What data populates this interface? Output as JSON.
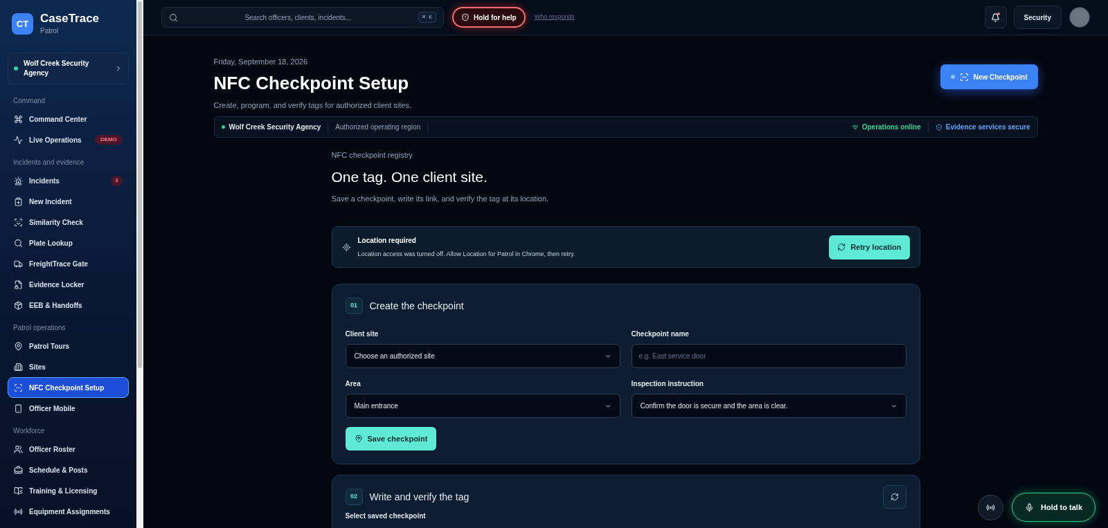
{
  "sidebar": {
    "brand": {
      "logo": "CT",
      "name": "CaseTrace",
      "product": "Patrol"
    },
    "agency": {
      "name": "Wolf Creek Security Agency",
      "online": true
    },
    "sections": [
      {
        "label": "Command",
        "items": [
          {
            "label": "Command Center",
            "selected": false
          },
          {
            "label": "Live Operations",
            "selected": false,
            "badge": {
              "kind": "demo",
              "text": "DEMO"
            }
          }
        ]
      },
      {
        "label": "Incidents and evidence",
        "items": [
          {
            "label": "Incidents",
            "selected": false,
            "badge": {
              "kind": "count",
              "text": "3"
            }
          },
          {
            "label": "New Incident",
            "selected": false
          },
          {
            "label": "Similarity Check",
            "selected": false
          },
          {
            "label": "Plate Lookup",
            "selected": false
          },
          {
            "label": "FreightTrace Gate",
            "selected": false
          },
          {
            "label": "Evidence Locker",
            "selected": false
          },
          {
            "label": "EEB & Handoffs",
            "selected": false
          }
        ]
      },
      {
        "label": "Patrol operations",
        "items": [
          {
            "label": "Patrol Tours",
            "selected": false
          },
          {
            "label": "Sites",
            "selected": false
          },
          {
            "label": "NFC Checkpoint Setup",
            "selected": true
          },
          {
            "label": "Officer Mobile",
            "selected": false
          }
        ]
      },
      {
        "label": "Workforce",
        "items": [
          {
            "label": "Officer Roster",
            "selected": false
          },
          {
            "label": "Schedule & Posts",
            "selected": false
          },
          {
            "label": "Training & Licensing",
            "selected": false
          },
          {
            "label": "Equipment Assignments",
            "selected": false
          }
        ]
      }
    ]
  },
  "topbar": {
    "search": {
      "placeholder": "Search officers, clients, incidents...",
      "shortcut": "⌘ K"
    },
    "help_button": "Hold for help",
    "help_link": "Who responds",
    "notifications": {
      "unread": true
    },
    "role_button": "Security"
  },
  "page": {
    "date": "Friday, September 18, 2026",
    "title": "NFC Checkpoint Setup",
    "subtitle": "Create, program, and verify tags for authorized client sites.",
    "primary_button": "New Checkpoint",
    "status_strip": {
      "agency": "Wolf Creek Security Agency",
      "region": "Authorized operating region",
      "operations": "Operations online",
      "evidence": "Evidence services secure"
    }
  },
  "registry": {
    "eyebrow": "NFC checkpoint registry",
    "heading": "One tag. One client site.",
    "description": "Save a checkpoint, write its link, and verify the tag at its location."
  },
  "alert": {
    "title": "Location required",
    "message": "Location access was turned off. Allow Location for Patrol in Chrome, then retry.",
    "button": "Retry location"
  },
  "steps": [
    {
      "number": "01",
      "title": "Create the checkpoint",
      "fields": [
        {
          "label": "Client site",
          "kind": "select",
          "value": "Choose an authorized site"
        },
        {
          "label": "Checkpoint name",
          "kind": "input",
          "placeholder": "e.g. East service door"
        },
        {
          "label": "Area",
          "kind": "select",
          "value": "Main entrance"
        },
        {
          "label": "Inspection instruction",
          "kind": "select",
          "value": "Confirm the door is secure and the area is clear."
        }
      ],
      "button": "Save checkpoint"
    },
    {
      "number": "02",
      "title": "Write and verify the tag",
      "fields": [
        {
          "label": "Select saved checkpoint",
          "kind": "label"
        }
      ]
    }
  ],
  "voice": {
    "button": "Hold to talk"
  }
}
